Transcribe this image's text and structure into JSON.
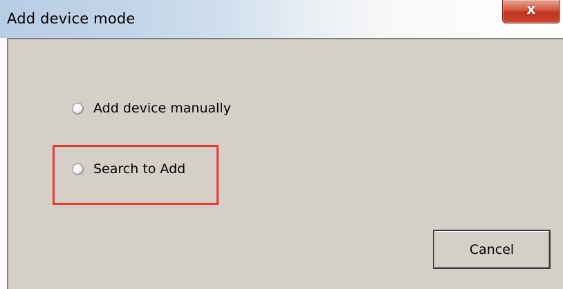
{
  "window": {
    "title": "Add device mode"
  },
  "options": [
    {
      "label": "Add device manually",
      "selected": false
    },
    {
      "label": "Search to Add",
      "selected": false
    }
  ],
  "buttons": {
    "close_glyph": "x",
    "cancel_label": "Cancel"
  },
  "colors": {
    "client_background": "#d4d0c8",
    "highlight_border": "#e83a32",
    "close_button": "#c9452f"
  }
}
